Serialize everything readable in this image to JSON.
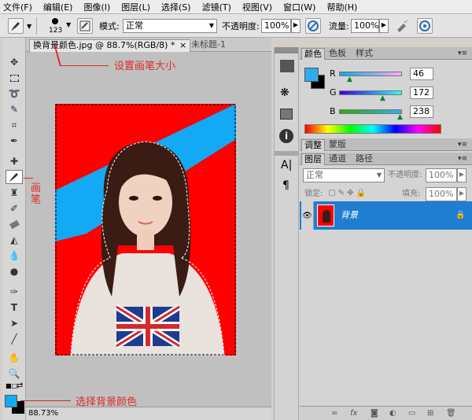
{
  "menu": [
    "文件(F)",
    "编辑(E)",
    "图像(I)",
    "图层(L)",
    "选择(S)",
    "滤镜(T)",
    "视图(V)",
    "窗口(W)",
    "帮助(H)"
  ],
  "options": {
    "brush_size": "123",
    "mode_label": "模式:",
    "mode_value": "正常",
    "opacity_label": "不透明度:",
    "opacity_value": "100%",
    "flow_label": "流量:",
    "flow_value": "100%"
  },
  "document": {
    "tab_active": "换背景颜色.jpg @ 88.7%(RGB/8) *",
    "tab_close": "×",
    "tab_other": "未标题-1",
    "zoom": "88.73%"
  },
  "annotations": {
    "brush_size": "设置画笔大小",
    "brush_tool": "画笔",
    "select_bg": "选择背景颜色"
  },
  "color_panel": {
    "tabs": [
      "颜色",
      "色板",
      "样式"
    ],
    "r_label": "R",
    "r_value": "46",
    "g_label": "G",
    "g_value": "172",
    "b_label": "B",
    "b_value": "238",
    "foreground": "#2eacee",
    "background": "#000000"
  },
  "adjust_panel": {
    "tabs": [
      "调整",
      "蒙版"
    ]
  },
  "layers_panel": {
    "tabs": [
      "图层",
      "通道",
      "路径"
    ],
    "blend_mode": "正常",
    "opacity_label": "不透明度:",
    "opacity_value": "100%",
    "lock_label": "锁定:",
    "fill_label": "填充:",
    "fill_value": "100%",
    "layer_name": "背景"
  },
  "colors": {
    "canvas_red": "#ff0000",
    "band_blue": "#14a9f5",
    "annotation_red": "#e0292c",
    "layer_selected": "#1f7ed0"
  }
}
